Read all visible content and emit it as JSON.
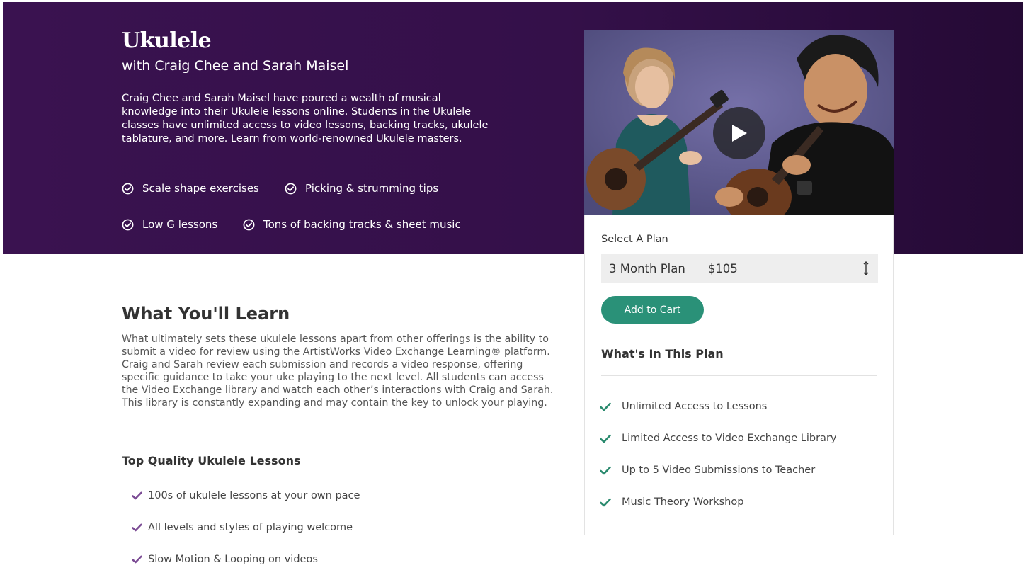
{
  "hero": {
    "title": "Ukulele",
    "subtitle": "with Craig Chee and Sarah Maisel",
    "description": "Craig Chee and Sarah Maisel have poured a wealth of musical knowledge into their Ukulele lessons online. Students in the Ukulele classes have unlimited access to video lessons, backing tracks, ukulele tablature, and more. Learn from world-renowned Ukulele masters.",
    "features": [
      "Scale shape exercises",
      "Picking & strumming tips",
      "Low G lessons",
      "Tons of backing tracks & sheet music"
    ]
  },
  "video": {
    "play_icon": "play-icon"
  },
  "plan": {
    "label": "Select A Plan",
    "selected_name": "3 Month Plan",
    "selected_price": "$105",
    "add_to_cart": "Add to Cart",
    "heading": "What's In This Plan",
    "items": [
      "Unlimited Access to Lessons",
      "Limited Access to Video Exchange Library",
      "Up to 5 Video Submissions to Teacher",
      "Music Theory Workshop"
    ]
  },
  "learn": {
    "title": "What You'll Learn",
    "body": "What ultimately sets these ukulele lessons apart from other offerings is the ability to submit a video for review using the ArtistWorks Video Exchange Learning® platform. Craig and Sarah review each submission and records a video response, offering specific guidance to take your uke playing to the next level. All students can access the Video Exchange library and watch each other’s interactions with Craig and Sarah. This library is constantly expanding and may contain the key to unlock your playing.",
    "quality_title": "Top Quality Ukulele Lessons",
    "quality_items": [
      "100s of ukulele lessons at your own pace",
      "All levels and styles of playing welcome",
      "Slow Motion & Looping on videos"
    ]
  },
  "colors": {
    "hero_bg": "#3a1250",
    "accent_green": "#2a9178",
    "check_green": "#2a8a6e",
    "check_purple": "#7b4b94"
  }
}
